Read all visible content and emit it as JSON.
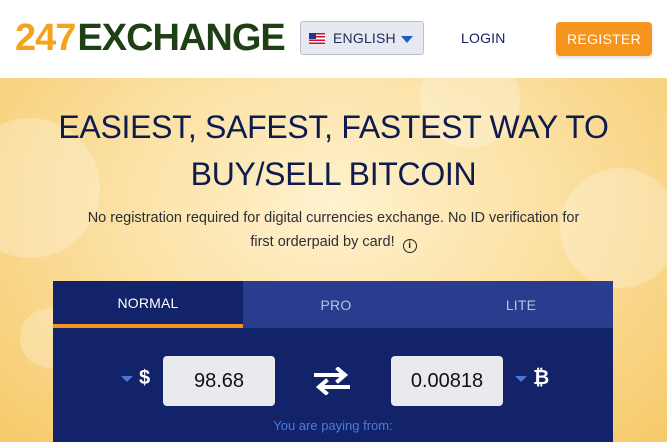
{
  "header": {
    "logo_number": "247",
    "logo_word": "EXCHANGE",
    "language": {
      "label": "ENGLISH",
      "flag": "us-flag-icon"
    },
    "login_label": "LOGIN",
    "register_label": "REGISTER"
  },
  "hero": {
    "title_line1": "EASIEST, SAFEST, FASTEST WAY TO",
    "title_line2": "BUY/SELL BITCOIN",
    "subtitle_line1": "No registration required for digital currencies exchange. No ID verification for",
    "subtitle_line2": "first orderpaid by card!"
  },
  "widget": {
    "tabs": [
      {
        "label": "NORMAL",
        "active": true
      },
      {
        "label": "PRO",
        "active": false
      },
      {
        "label": "LITE",
        "active": false
      }
    ],
    "from_currency_symbol": "$",
    "from_amount": "98.68",
    "to_currency_symbol": "₿",
    "to_amount": "0.00818",
    "paying_from_label": "You are paying from:"
  },
  "colors": {
    "accent_orange": "#f7941d",
    "navy": "#13236a",
    "tab_inactive": "#2a3c8e",
    "logo_green": "#1f3f14"
  }
}
